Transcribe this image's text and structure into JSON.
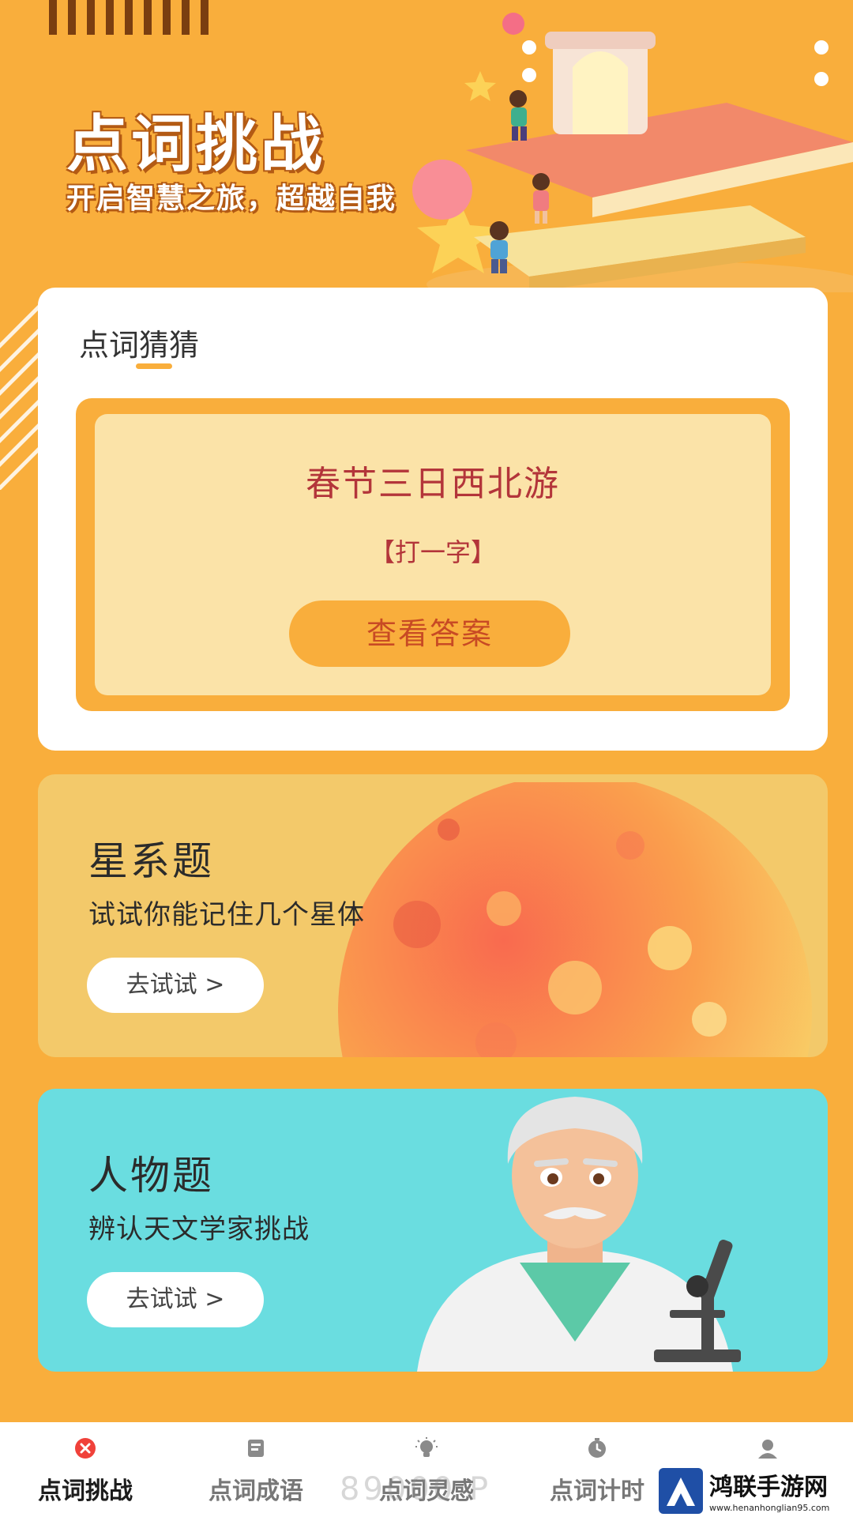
{
  "hero": {
    "title": "点词挑战",
    "subtitle": "开启智慧之旅，超越自我"
  },
  "riddle_card": {
    "section_title": "点词猜猜",
    "question": "春节三日西北游",
    "hint": "【打一字】",
    "answer_button": "查看答案"
  },
  "cards": [
    {
      "title": "星系题",
      "desc": "试试你能记住几个星体",
      "button": "去试试 >"
    },
    {
      "title": "人物题",
      "desc": "辨认天文学家挑战",
      "button": "去试试 >"
    }
  ],
  "tabs": [
    {
      "label": "点词挑战",
      "icon": "close-circle-icon",
      "active": true
    },
    {
      "label": "点词成语",
      "icon": "book-icon",
      "active": false
    },
    {
      "label": "点词灵感",
      "icon": "lightbulb-icon",
      "active": false
    },
    {
      "label": "点词计时",
      "icon": "timer-icon",
      "active": false
    },
    {
      "label": "",
      "icon": "user-icon",
      "active": false
    }
  ],
  "watermark": {
    "number": "89000 P",
    "brand": "鸿联手游网",
    "url": "www.henanhonglian95.com"
  },
  "colors": {
    "background": "#F9AE3C",
    "riddle_text": "#B3353A",
    "star_card": "#F3C96A",
    "person_card": "#6ADDE0"
  }
}
